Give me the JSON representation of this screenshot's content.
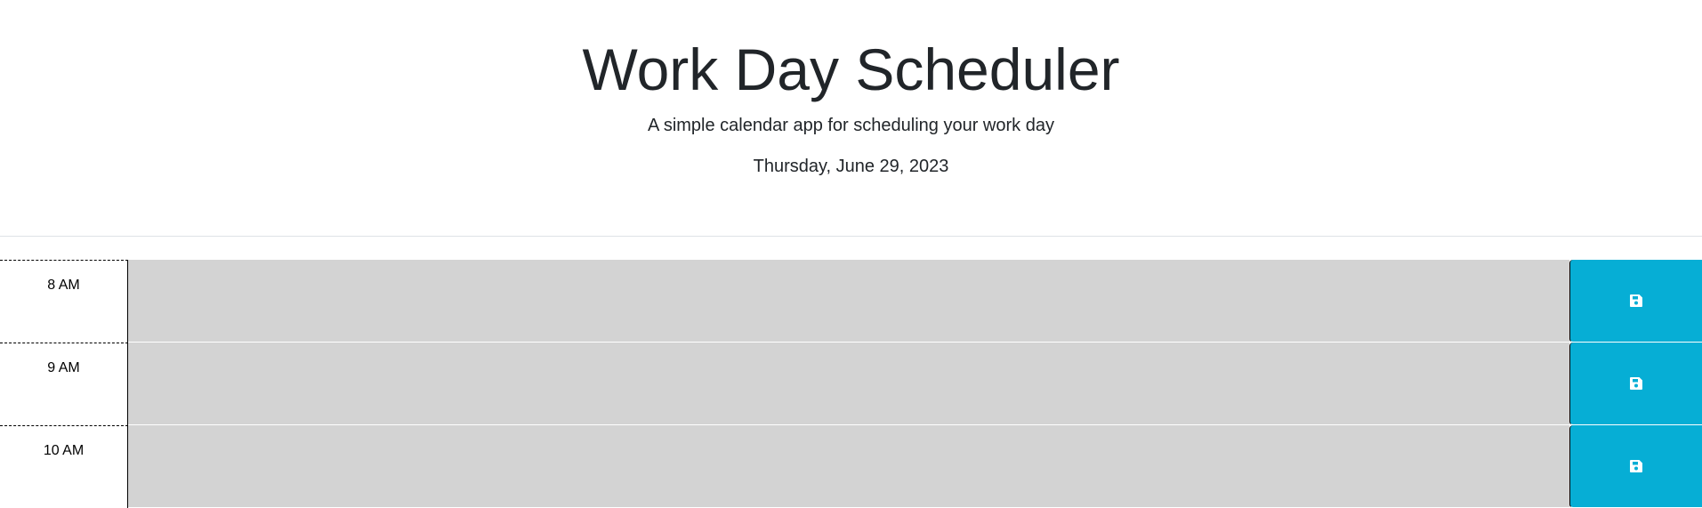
{
  "header": {
    "title": "Work Day Scheduler",
    "subtitle": "A simple calendar app for scheduling your work day",
    "current_day": "Thursday, June 29, 2023"
  },
  "colors": {
    "time_block_past": "#d3d3d3",
    "save_button": "#06aed5",
    "save_icon": "#ffffff"
  },
  "schedule": {
    "rows": [
      {
        "hour": "8 AM",
        "description": "",
        "save_icon": "floppy-disk-icon"
      },
      {
        "hour": "9 AM",
        "description": "",
        "save_icon": "floppy-disk-icon"
      },
      {
        "hour": "10 AM",
        "description": "",
        "save_icon": "floppy-disk-icon"
      }
    ]
  }
}
